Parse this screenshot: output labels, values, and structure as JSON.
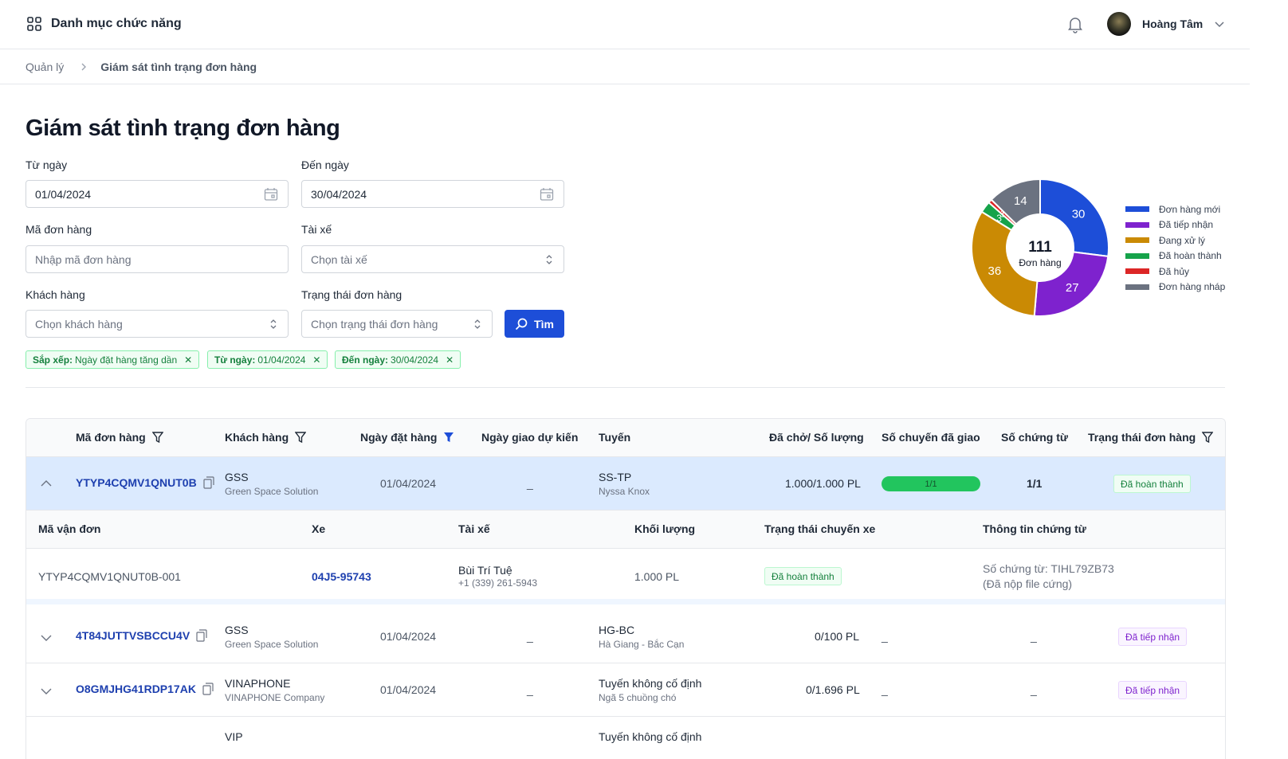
{
  "topbar": {
    "menu_label": "Danh mục chức năng",
    "user_name": "Hoàng Tâm"
  },
  "breadcrumb": {
    "parent": "Quản lý",
    "current": "Giám sát tình trạng đơn hàng"
  },
  "page_title": "Giám sát tình trạng đơn hàng",
  "filters": {
    "from_label": "Từ ngày",
    "from_value": "01/04/2024",
    "to_label": "Đến ngày",
    "to_value": "30/04/2024",
    "order_code_label": "Mã đơn hàng",
    "order_code_placeholder": "Nhập mã đơn hàng",
    "driver_label": "Tài xế",
    "driver_placeholder": "Chọn tài xế",
    "customer_label": "Khách hàng",
    "customer_placeholder": "Chọn khách hàng",
    "status_label": "Trạng thái đơn hàng",
    "status_placeholder": "Chọn trạng thái đơn hàng",
    "search_label": "Tìm"
  },
  "chips": [
    {
      "key": "Sắp xếp:",
      "value": "Ngày đặt hàng tăng dần"
    },
    {
      "key": "Từ ngày:",
      "value": "01/04/2024"
    },
    {
      "key": "Đến ngày:",
      "value": "30/04/2024"
    }
  ],
  "chart_data": {
    "type": "pie",
    "center_value": "111",
    "center_label": "Đơn hàng",
    "categories": [
      "Đơn hàng mới",
      "Đã tiếp nhận",
      "Đang xử lý",
      "Đã hoàn thành",
      "Đã hủy",
      "Đơn hàng nháp"
    ],
    "values": [
      30,
      27,
      36,
      3,
      1,
      14
    ],
    "colors": [
      "#1d4ed8",
      "#7e22ce",
      "#ca8a04",
      "#16a34a",
      "#dc2626",
      "#6b7280"
    ],
    "legend_position": "right"
  },
  "table": {
    "headers": [
      "Mã đơn hàng",
      "Khách hàng",
      "Ngày đặt hàng",
      "Ngày giao dự kiến",
      "Tuyến",
      "Đã chở/ Số lượng",
      "Số chuyến đã giao",
      "Số chứng từ",
      "Trạng thái đơn hàng"
    ],
    "rows": [
      {
        "code": "YTYP4CQMV1QNUT0B",
        "customer": "GSS",
        "customer_sub": "Green Space Solution",
        "date": "01/04/2024",
        "eta": "_",
        "route": "SS-TP",
        "route_sub": "Nyssa Knox",
        "qty": "1.000/1.000 PL",
        "trips": "1/1",
        "docs": "1/1",
        "status": "Đã hoàn thành"
      },
      {
        "code": "4T84JUTTVSBCCU4V",
        "customer": "GSS",
        "customer_sub": "Green Space Solution",
        "date": "01/04/2024",
        "eta": "_",
        "route": "HG-BC",
        "route_sub": "Hà Giang - Bắc Cạn",
        "qty": "0/100 PL",
        "trips": "_",
        "docs": "_",
        "status": "Đã tiếp nhận"
      },
      {
        "code": "O8GMJHG41RDP17AK",
        "customer": "VINAPHONE",
        "customer_sub": "VINAPHONE Company",
        "date": "01/04/2024",
        "eta": "_",
        "route": "Tuyến không cố định",
        "route_sub": "Ngã 5 chuồng chó",
        "qty": "0/1.696 PL",
        "trips": "_",
        "docs": "_",
        "status": "Đã tiếp nhận"
      },
      {
        "customer": "VIP",
        "route": "Tuyến không cố định"
      }
    ],
    "detail": {
      "headers": [
        "Mã vận đơn",
        "Xe",
        "Tài xế",
        "Khối lượng",
        "Trạng thái chuyến xe",
        "Thông tin chứng từ"
      ],
      "row": {
        "waybill": "YTYP4CQMV1QNUT0B-001",
        "vehicle": "04J5-95743",
        "driver": "Bùi Trí Tuệ",
        "driver_phone": "+1 (339) 261-5943",
        "weight": "1.000 PL",
        "trip_status": "Đã hoàn thành",
        "doc_no": "Số chứng từ: TIHL79ZB73",
        "doc_note": "(Đã nộp file cứng)"
      }
    }
  }
}
